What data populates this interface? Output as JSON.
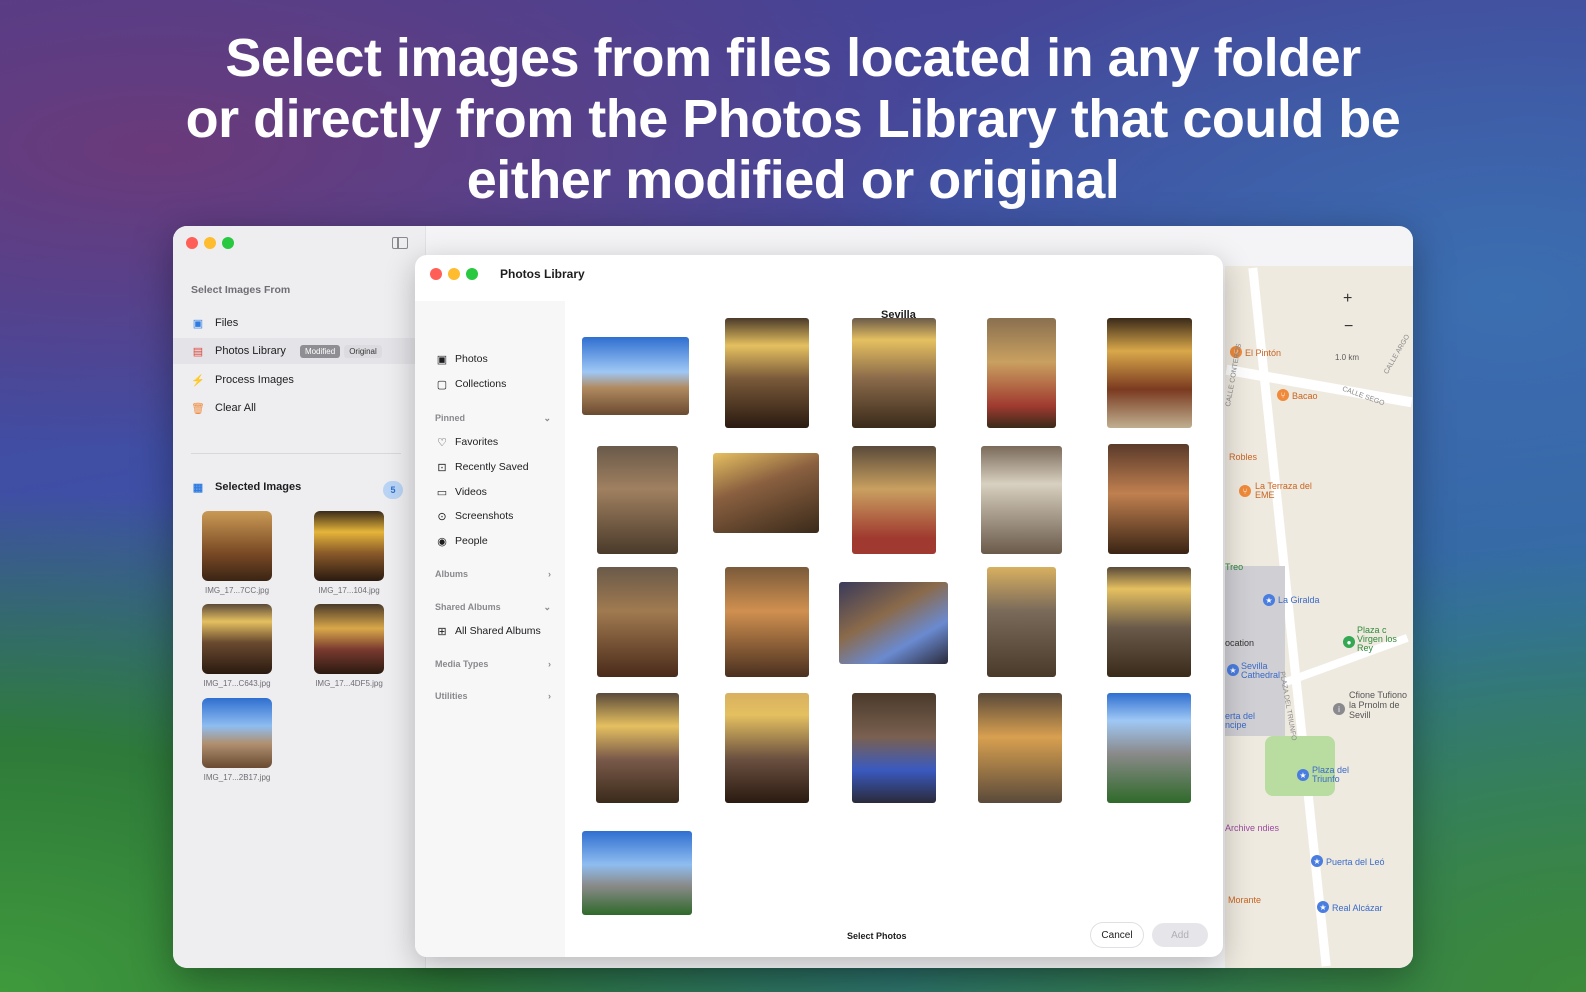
{
  "headline": {
    "line1": "Select images from files located in any folder",
    "line2": "or directly from the Photos Library that could be",
    "line3": "either modified or original"
  },
  "main_window": {
    "section_label": "Select Images From",
    "items": [
      {
        "label": "Files",
        "icon": "files-icon"
      },
      {
        "label": "Photos Library",
        "icon": "photos-library-icon",
        "pills": [
          "Modified",
          "Original"
        ],
        "selected_pill": "Modified"
      },
      {
        "label": "Process Images",
        "icon": "process-icon"
      },
      {
        "label": "Clear All",
        "icon": "trash-icon"
      }
    ],
    "selected_images": {
      "label": "Selected Images",
      "count": "5",
      "files": [
        "IMG_17...7CC.jpg",
        "IMG_17...104.jpg",
        "IMG_17...C643.jpg",
        "IMG_17...4DF5.jpg",
        "IMG_17...2B17.jpg"
      ]
    }
  },
  "photos_dialog": {
    "title": "Photos Library",
    "top_items": [
      "Photos",
      "Collections"
    ],
    "pinned": {
      "label": "Pinned",
      "items": [
        "Favorites",
        "Recently Saved",
        "Videos",
        "Screenshots",
        "People"
      ]
    },
    "albums_label": "Albums",
    "shared_albums": {
      "label": "Shared Albums",
      "items": [
        "All Shared Albums"
      ]
    },
    "media_types_label": "Media Types",
    "utilities_label": "Utilities",
    "grid_title": "Sevilla",
    "footer_title": "Select Photos",
    "cancel_label": "Cancel",
    "add_label": "Add"
  },
  "map": {
    "zoom_in": "+",
    "zoom_out": "−",
    "scale": "1.0 km",
    "labels": [
      "El Pintón",
      "Bacao",
      "Robles",
      "La Terraza del EME",
      "La Giralda",
      "Sevilla Cathedral",
      "Plaza del Triunfo",
      "Puerta del Leó",
      "Real Alcázar",
      "Morante",
      "Archive ndies",
      "Plaza c Virgen los Rey",
      "Cfione Tufiono la Prnolm de Sevill",
      "ocation",
      "erta del ncipe",
      "CALLE CONTEROS",
      "CALLE SEGO",
      "CALLE ARGO",
      "PLAZA DEL TRIUNFO",
      "Treo"
    ]
  },
  "colors": {
    "accent": "#2f7be0",
    "traffic_red": "#ff5f57",
    "traffic_yellow": "#febc2e",
    "traffic_green": "#28c840"
  }
}
